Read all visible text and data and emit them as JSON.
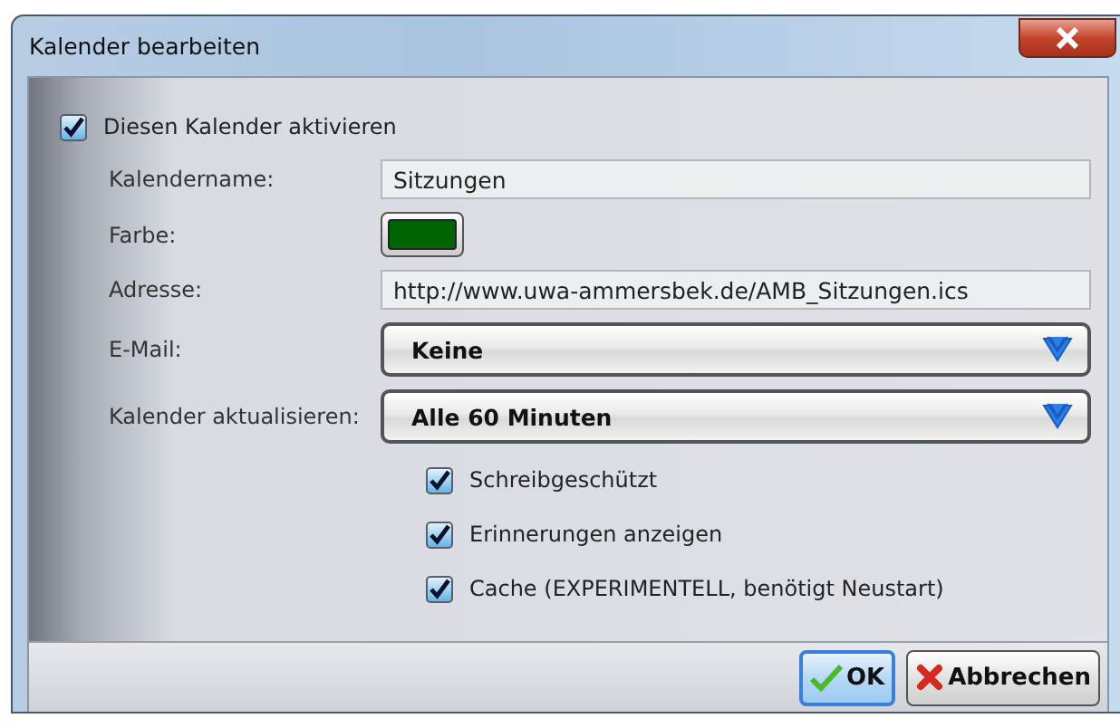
{
  "window": {
    "title": "Kalender bearbeiten"
  },
  "enable": {
    "label": "Diesen Kalender aktivieren",
    "checked": true
  },
  "fields": [
    {
      "kind": "text",
      "label": "Kalendername:",
      "value": "Sitzungen"
    },
    {
      "kind": "color",
      "label": "Farbe:",
      "color": "#006400"
    },
    {
      "kind": "text",
      "label": "Adresse:",
      "value": "http://www.uwa-ammersbek.de/AMB_Sitzungen.ics"
    },
    {
      "kind": "dropdown",
      "label": "E-Mail:",
      "value": "Keine"
    },
    {
      "kind": "dropdown",
      "label": "Kalender aktualisieren:",
      "value": "Alle 60 Minuten"
    }
  ],
  "options": [
    {
      "label": "Schreibgeschützt",
      "checked": true
    },
    {
      "label": "Erinnerungen anzeigen",
      "checked": true
    },
    {
      "label": "Cache (EXPERIMENTELL, benötigt Neustart)",
      "checked": true
    }
  ],
  "buttons": [
    {
      "kind": "ok",
      "label": "OK"
    },
    {
      "kind": "cancel",
      "label": "Abbrechen"
    }
  ]
}
